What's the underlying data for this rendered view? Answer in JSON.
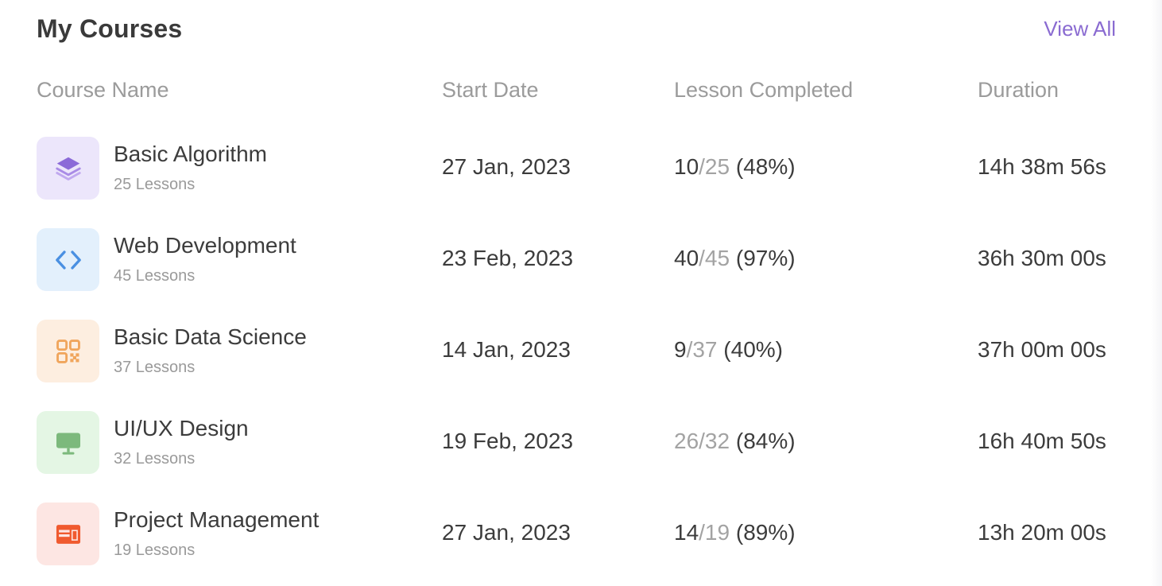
{
  "header": {
    "title": "My Courses",
    "view_all": "View All"
  },
  "columns": {
    "course_name": "Course Name",
    "start_date": "Start Date",
    "lesson_completed": "Lesson Completed",
    "duration": "Duration"
  },
  "courses": [
    {
      "name": "Basic Algorithm",
      "lessons": "25 Lessons",
      "start_date": "27 Jan, 2023",
      "completed": "10",
      "slash_total": "/25",
      "percent": "(48%)",
      "duration": "14h 38m 56s",
      "icon": "layers-icon",
      "icon_bg": "#ece6fb",
      "icon_color": "#8b6ad8"
    },
    {
      "name": "Web Development",
      "lessons": "45 Lessons",
      "start_date": "23 Feb, 2023",
      "completed": "40",
      "slash_total": "/45",
      "percent": "(97%)",
      "duration": "36h 30m 00s",
      "icon": "code-icon",
      "icon_bg": "#e3f0fc",
      "icon_color": "#4a90e2"
    },
    {
      "name": "Basic Data Science",
      "lessons": "37 Lessons",
      "start_date": "14 Jan, 2023",
      "completed": "9",
      "slash_total": "/37",
      "percent": "(40%)",
      "duration": "37h 00m 00s",
      "icon": "qr-code-icon",
      "icon_bg": "#fdeee0",
      "icon_color": "#f0a55c"
    },
    {
      "name": "UI/UX Design",
      "lessons": "32 Lessons",
      "start_date": "19 Feb, 2023",
      "completed": "26",
      "slash_total": "/32",
      "percent": "(84%)",
      "duration": "16h 40m 50s",
      "icon": "monitor-icon",
      "icon_bg": "#e4f6e4",
      "icon_color": "#7cb97c"
    },
    {
      "name": "Project Management",
      "lessons": "19 Lessons",
      "start_date": "27 Jan, 2023",
      "completed": "14",
      "slash_total": "/19",
      "percent": "(89%)",
      "duration": "13h 20m 00s",
      "icon": "layout-icon",
      "icon_bg": "#fde6e3",
      "icon_color": "#f05a2f"
    }
  ]
}
